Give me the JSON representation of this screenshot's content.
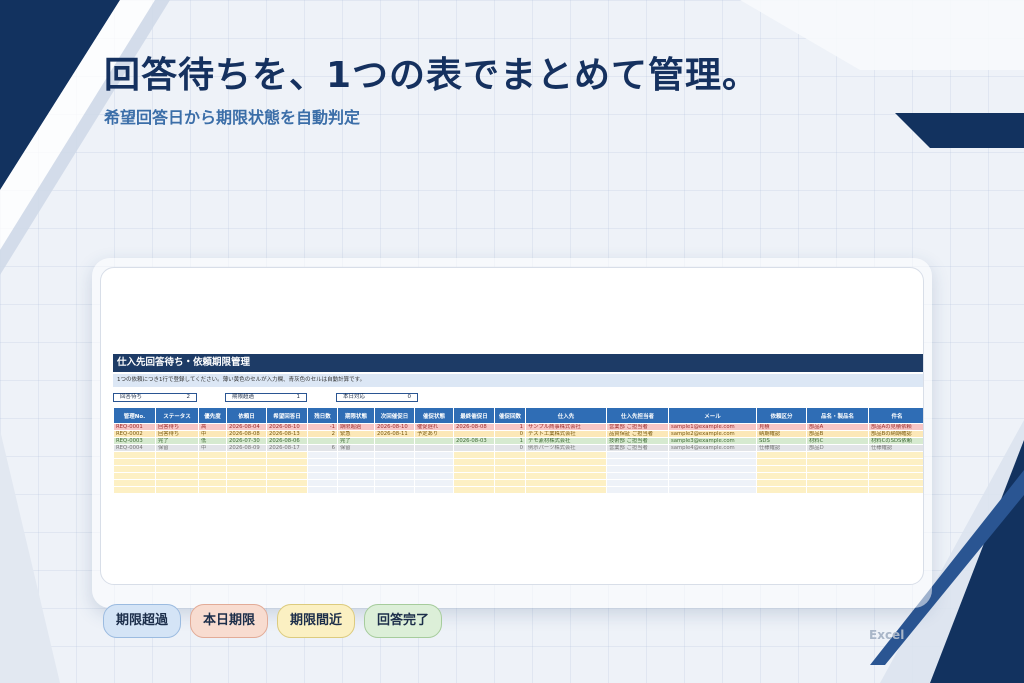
{
  "hero": {
    "title": "回答待ちを、1つの表でまとめて管理。",
    "subtitle": "希望回答日から期限状態を自動判定"
  },
  "sheet": {
    "title": "仕入先回答待ち・依頼期限管理",
    "note": "1つの依頼につき1行で登録してください。薄い黄色のセルが入力欄、青灰色のセルは自動計算です。",
    "summary": [
      {
        "label": "回答待ち",
        "value": "2"
      },
      {
        "label": "期限超過",
        "value": "1"
      },
      {
        "label": "本日対応",
        "value": "0"
      }
    ],
    "columns": [
      "管理No.",
      "ステータス",
      "優先度",
      "依頼日",
      "希望回答日",
      "残日数",
      "期限状態",
      "次回催促日",
      "催促状態",
      "最終催促日",
      "催促回数",
      "仕入先",
      "仕入先担当者",
      "メール",
      "依頼区分",
      "品名・製品名",
      "件名"
    ],
    "rows": [
      [
        "REQ-0001",
        "回答待ち",
        "高",
        "2026-08-04",
        "2026-08-10",
        "-1",
        "期限超過",
        "2026-08-10",
        "催促遅れ",
        "2026-08-08",
        "1",
        "サンプル商事株式会社",
        "営業部 ご担当者",
        "sample1@example.com",
        "見積",
        "部品A",
        "部品Aの見積依頼"
      ],
      [
        "REQ-0002",
        "回答待ち",
        "中",
        "2026-08-08",
        "2026-08-13",
        "2",
        "緊急",
        "2026-08-11",
        "予定あり",
        "",
        "0",
        "テスト工業株式会社",
        "品質保証 ご担当者",
        "sample2@example.com",
        "納期確認",
        "部品B",
        "部品Bの納期確認"
      ],
      [
        "REQ-0003",
        "完了",
        "低",
        "2026-07-30",
        "2026-08-06",
        "",
        "完了",
        "",
        "",
        "2026-08-03",
        "1",
        "デモ素材株式会社",
        "技術部 ご担当者",
        "sample3@example.com",
        "SDS",
        "材料C",
        "材料CのSDS依頼"
      ],
      [
        "REQ-0004",
        "保留",
        "中",
        "2026-08-09",
        "2026-08-17",
        "6",
        "保留",
        "",
        "",
        "",
        "0",
        "例示パーツ株式会社",
        "営業部 ご担当者",
        "sample4@example.com",
        "仕様確認",
        "部品D",
        "仕様確認"
      ]
    ]
  },
  "legend": [
    "期限超過",
    "本日期限",
    "期限間近",
    "回答完了"
  ],
  "footer": {
    "app_label": "Excel"
  },
  "colors": {
    "navy": "#15315f",
    "header_blue": "#2f6db5",
    "overdue": "#f7c6c6",
    "today": "#f8dcd0",
    "soon": "#fbf0c2",
    "done": "#dcefd8"
  }
}
